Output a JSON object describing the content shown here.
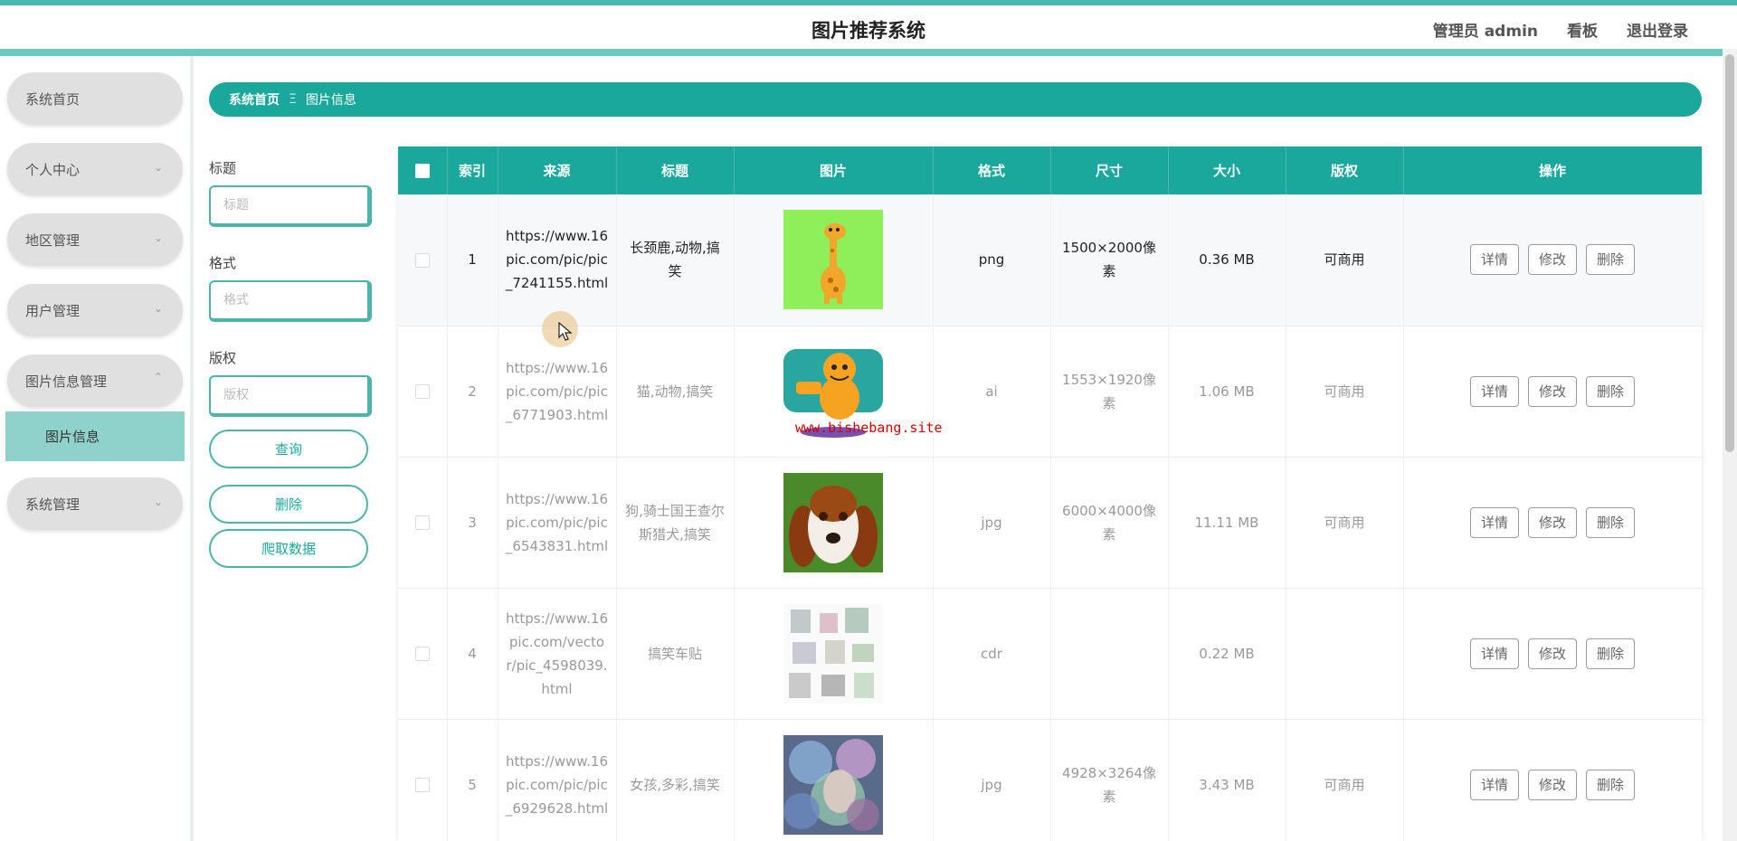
{
  "header": {
    "title": "图片推荐系统",
    "user": "管理员 admin",
    "dashboard": "看板",
    "logout": "退出登录"
  },
  "sidebar": {
    "items": [
      {
        "label": "系统首页"
      },
      {
        "label": "个人中心"
      },
      {
        "label": "地区管理"
      },
      {
        "label": "用户管理"
      },
      {
        "label": "图片信息管理"
      },
      {
        "label": "系统管理"
      }
    ],
    "sub_item": "图片信息"
  },
  "breadcrumb": {
    "home": "系统首页",
    "separator": "Ξ",
    "current": "图片信息"
  },
  "filters": {
    "title_label": "标题",
    "title_placeholder": "标题",
    "format_label": "格式",
    "format_placeholder": "格式",
    "copyright_label": "版权",
    "copyright_placeholder": "版权",
    "query_btn": "查询",
    "delete_btn": "删除",
    "crawl_btn": "爬取数据"
  },
  "table": {
    "headers": [
      "索引",
      "来源",
      "标题",
      "图片",
      "格式",
      "尺寸",
      "大小",
      "版权",
      "操作"
    ],
    "rows": [
      {
        "index": "1",
        "source": "https://www.16pic.com/pic/pic_7241155.html",
        "title": "长颈鹿,动物,搞笑",
        "format": "png",
        "size": "1500×2000像素",
        "filesize": "0.36 MB",
        "copyright": "可商用"
      },
      {
        "index": "2",
        "source": "https://www.16pic.com/pic/pic_6771903.html",
        "title": "猫,动物,搞笑",
        "format": "ai",
        "size": "1553×1920像素",
        "filesize": "1.06 MB",
        "copyright": "可商用"
      },
      {
        "index": "3",
        "source": "https://www.16pic.com/pic/pic_6543831.html",
        "title": "狗,骑士国王查尔斯猎犬,搞笑",
        "format": "jpg",
        "size": "6000×4000像素",
        "filesize": "11.11 MB",
        "copyright": "可商用"
      },
      {
        "index": "4",
        "source": "https://www.16pic.com/vector/pic_4598039.html",
        "title": "搞笑车贴",
        "format": "cdr",
        "size": "",
        "filesize": "0.22 MB",
        "copyright": ""
      },
      {
        "index": "5",
        "source": "https://www.16pic.com/pic/pic_6929628.html",
        "title": "女孩,多彩,搞笑",
        "format": "jpg",
        "size": "4928×3264像素",
        "filesize": "3.43 MB",
        "copyright": "可商用"
      }
    ],
    "actions": {
      "detail": "详情",
      "edit": "修改",
      "delete": "删除"
    }
  },
  "watermark": "www.bishebang.site",
  "colors": {
    "accent": "#1aa89c",
    "accent_light": "#8fd1cb",
    "sidebar_item": "#e0e0e0"
  }
}
